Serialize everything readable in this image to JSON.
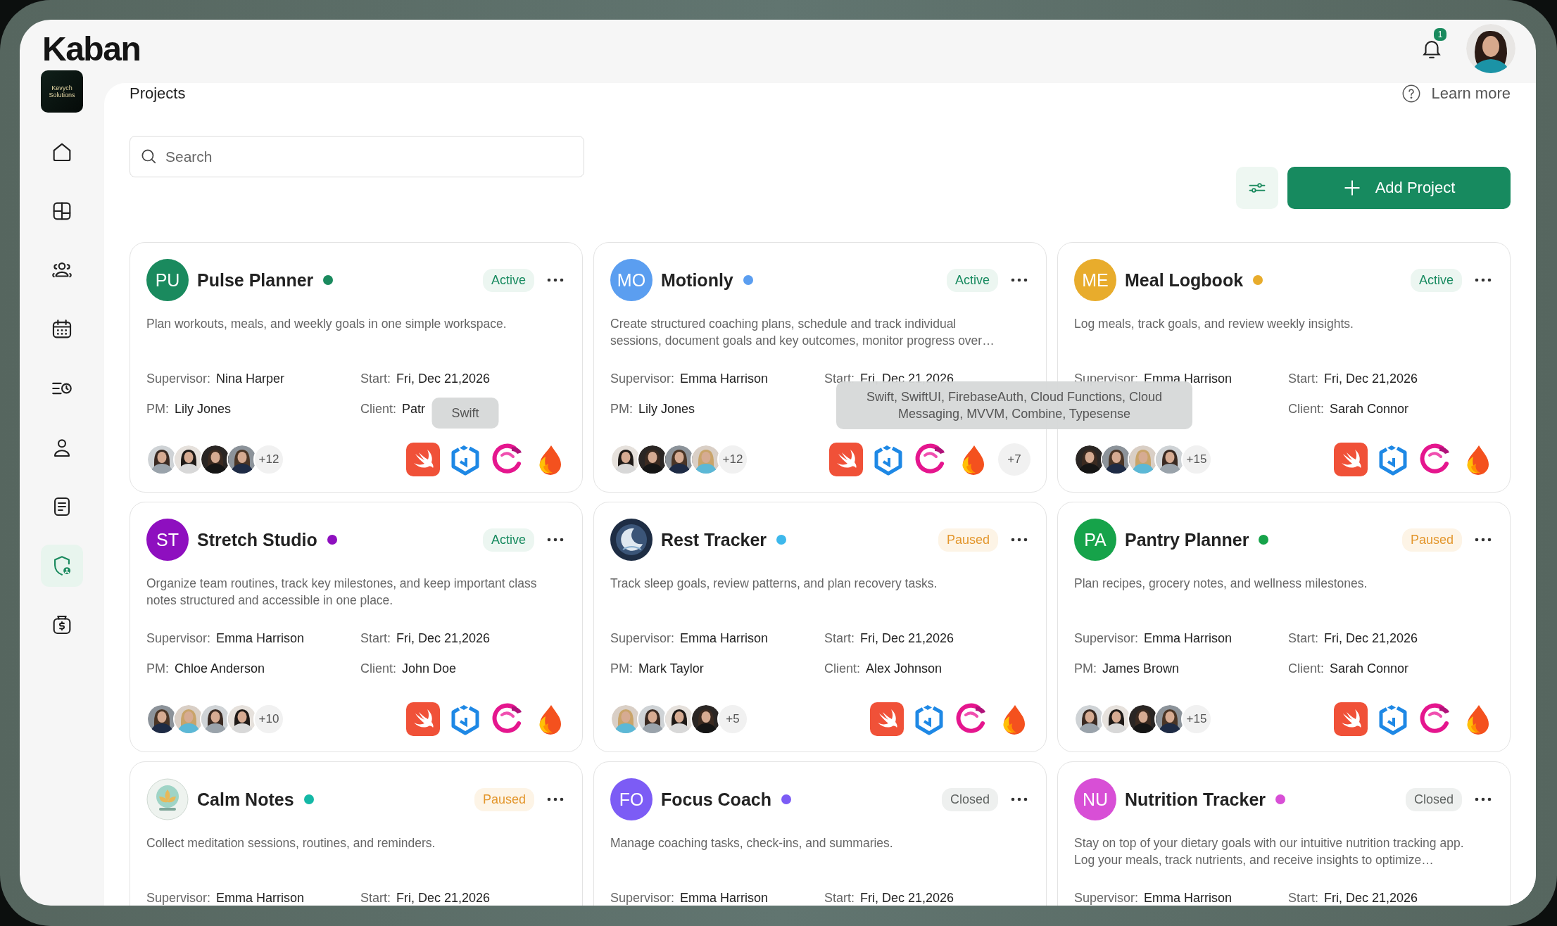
{
  "header": {
    "logo": "Kaban",
    "notifications": "1",
    "user_avatar": {
      "kind": "picture"
    }
  },
  "sidebar": {
    "company_logo": "Kevych Solutions",
    "items": [
      {
        "kind": "home",
        "selected": false
      },
      {
        "kind": "layout",
        "selected": false
      },
      {
        "kind": "team",
        "selected": false
      },
      {
        "kind": "calendar",
        "selected": false
      },
      {
        "kind": "timeline",
        "selected": false
      },
      {
        "kind": "user",
        "selected": false
      },
      {
        "kind": "document",
        "selected": false
      },
      {
        "kind": "shield",
        "selected": true
      },
      {
        "kind": "money",
        "selected": false
      }
    ]
  },
  "page": {
    "title": "Projects",
    "help_link": "Learn more",
    "search": {
      "placeholder": "Search"
    },
    "add_button": "Add Project"
  },
  "projects": [
    {
      "name": "Pulse Planner",
      "badge": {
        "kind": "initials",
        "text": "PU"
      },
      "color": "#1a8a5e",
      "status": {
        "kind": "active",
        "text": "Active"
      },
      "description": "Plan workouts, meals, and weekly goals in one simple workspace.",
      "left_fields": [
        {
          "label": "Supervisor:",
          "value": "Nina Harper"
        },
        {
          "label": "PM:",
          "value": "Lily Jones"
        }
      ],
      "right_fields": [
        {
          "label": "Start:",
          "value": "Fri, Dec 21,2026"
        },
        {
          "label": "Client:",
          "value": "Patr"
        }
      ],
      "members": [
        {
          "kind": "picture"
        },
        {
          "kind": "picture"
        },
        {
          "kind": "picture"
        },
        {
          "kind": "picture"
        }
      ],
      "more_members": "+12",
      "tech": [
        {
          "kind": "swift"
        },
        {
          "kind": "hexagon",
          "tooltip": "Swift"
        },
        {
          "kind": "swirl"
        },
        {
          "kind": "flame"
        }
      ]
    },
    {
      "name": "Motionly",
      "badge": {
        "kind": "initials",
        "text": "MO"
      },
      "color": "#5b9ef0",
      "status": {
        "kind": "active",
        "text": "Active"
      },
      "description": "Create structured coaching plans, schedule and track individual sessions, document goals and key outcomes, monitor progress over…",
      "left_fields": [
        {
          "label": "Supervisor:",
          "value": "Emma Harrison"
        },
        {
          "label": "PM:",
          "value": "Lily Jones"
        }
      ],
      "right_fields": [
        {
          "label": "Start:",
          "value": "Fri, Dec 21,2026"
        }
      ],
      "members": [
        {
          "kind": "picture"
        },
        {
          "kind": "picture"
        },
        {
          "kind": "picture"
        },
        {
          "kind": "picture"
        }
      ],
      "more_members": "+12",
      "tech": [
        {
          "kind": "swift"
        },
        {
          "kind": "hexagon"
        },
        {
          "kind": "swirl"
        },
        {
          "kind": "flame"
        },
        {
          "kind": "more",
          "text": "+7",
          "tooltip": "Swift, SwiftUI, FirebaseAuth, Cloud Functions, Cloud Messaging, MVVM, Combine, Typesense"
        }
      ]
    },
    {
      "name": "Meal Logbook",
      "badge": {
        "kind": "initials",
        "text": "ME"
      },
      "color": "#e8ac2c",
      "status": {
        "kind": "active",
        "text": "Active"
      },
      "description": "Log meals, track goals, and review weekly insights.",
      "left_fields": [
        {
          "label": "Supervisor:",
          "value": "Emma Harrison"
        }
      ],
      "right_fields": [
        {
          "label": "Start:",
          "value": "Fri, Dec 21,2026"
        },
        {
          "label": "Client:",
          "value": "Sarah Connor"
        }
      ],
      "members": [
        {
          "kind": "picture"
        },
        {
          "kind": "picture"
        },
        {
          "kind": "picture"
        },
        {
          "kind": "picture"
        }
      ],
      "more_members": "+15",
      "tech": [
        {
          "kind": "swift"
        },
        {
          "kind": "hexagon"
        },
        {
          "kind": "swirl"
        },
        {
          "kind": "flame"
        }
      ]
    },
    {
      "name": "Stretch Studio",
      "badge": {
        "kind": "initials",
        "text": "ST"
      },
      "color": "#8e0fbf",
      "status": {
        "kind": "active",
        "text": "Active"
      },
      "description": "Organize team routines, track key milestones, and keep important class notes structured and accessible in one place.",
      "left_fields": [
        {
          "label": "Supervisor:",
          "value": "Emma Harrison"
        },
        {
          "label": "PM:",
          "value": "Chloe Anderson"
        }
      ],
      "right_fields": [
        {
          "label": "Start:",
          "value": "Fri, Dec 21,2026"
        },
        {
          "label": "Client:",
          "value": "John Doe"
        }
      ],
      "members": [
        {
          "kind": "picture"
        },
        {
          "kind": "picture"
        },
        {
          "kind": "picture"
        },
        {
          "kind": "picture"
        }
      ],
      "more_members": "+10",
      "tech": [
        {
          "kind": "swift"
        },
        {
          "kind": "hexagon"
        },
        {
          "kind": "swirl"
        },
        {
          "kind": "flame"
        }
      ]
    },
    {
      "name": "Rest Tracker",
      "badge": {
        "kind": "moon"
      },
      "color": "#3db8ec",
      "status": {
        "kind": "paused",
        "text": "Paused"
      },
      "description": "Track sleep goals, review patterns, and plan recovery tasks.",
      "left_fields": [
        {
          "label": "Supervisor:",
          "value": "Emma Harrison"
        },
        {
          "label": "PM:",
          "value": "Mark Taylor"
        }
      ],
      "right_fields": [
        {
          "label": "Start:",
          "value": "Fri, Dec 21,2026"
        },
        {
          "label": "Client:",
          "value": "Alex Johnson"
        }
      ],
      "members": [
        {
          "kind": "picture"
        },
        {
          "kind": "picture"
        },
        {
          "kind": "picture"
        },
        {
          "kind": "picture"
        }
      ],
      "more_members": "+5",
      "tech": [
        {
          "kind": "swift"
        },
        {
          "kind": "hexagon"
        },
        {
          "kind": "swirl"
        },
        {
          "kind": "flame"
        }
      ]
    },
    {
      "name": "Pantry Planner",
      "badge": {
        "kind": "initials",
        "text": "PA"
      },
      "color": "#16a34a",
      "status": {
        "kind": "paused",
        "text": "Paused"
      },
      "description": "Plan recipes, grocery notes, and wellness milestones.",
      "left_fields": [
        {
          "label": "Supervisor:",
          "value": "Emma Harrison"
        },
        {
          "label": "PM:",
          "value": "James Brown"
        }
      ],
      "right_fields": [
        {
          "label": "Start:",
          "value": "Fri, Dec 21,2026"
        },
        {
          "label": "Client:",
          "value": "Sarah Connor"
        }
      ],
      "members": [
        {
          "kind": "picture"
        },
        {
          "kind": "picture"
        },
        {
          "kind": "picture"
        },
        {
          "kind": "picture"
        }
      ],
      "more_members": "+15",
      "tech": [
        {
          "kind": "swift"
        },
        {
          "kind": "hexagon"
        },
        {
          "kind": "swirl"
        },
        {
          "kind": "flame"
        }
      ]
    },
    {
      "name": "Calm Notes",
      "badge": {
        "kind": "lotus"
      },
      "color": "#14b8a6",
      "status": {
        "kind": "paused",
        "text": "Paused"
      },
      "description": "Collect meditation sessions, routines, and reminders.",
      "left_fields": [
        {
          "label": "Supervisor:",
          "value": "Emma Harrison"
        }
      ],
      "right_fields": [
        {
          "label": "Start:",
          "value": "Fri, Dec 21,2026"
        }
      ]
    },
    {
      "name": "Focus Coach",
      "badge": {
        "kind": "initials",
        "text": "FO"
      },
      "color": "#7c5cf5",
      "status": {
        "kind": "closed",
        "text": "Closed"
      },
      "description": "Manage coaching tasks, check-ins, and summaries.",
      "left_fields": [
        {
          "label": "Supervisor:",
          "value": "Emma Harrison"
        }
      ],
      "right_fields": [
        {
          "label": "Start:",
          "value": "Fri, Dec 21,2026"
        }
      ]
    },
    {
      "name": "Nutrition Tracker",
      "badge": {
        "kind": "initials",
        "text": "NU"
      },
      "color": "#d84fd6",
      "status": {
        "kind": "closed",
        "text": "Closed"
      },
      "description": "Stay on top of your dietary goals with our intuitive nutrition tracking app. Log your meals, track nutrients, and receive insights to optimize…",
      "left_fields": [
        {
          "label": "Supervisor:",
          "value": "Emma Harrison"
        }
      ],
      "right_fields": [
        {
          "label": "Start:",
          "value": "Fri, Dec 21,2026"
        }
      ]
    }
  ]
}
